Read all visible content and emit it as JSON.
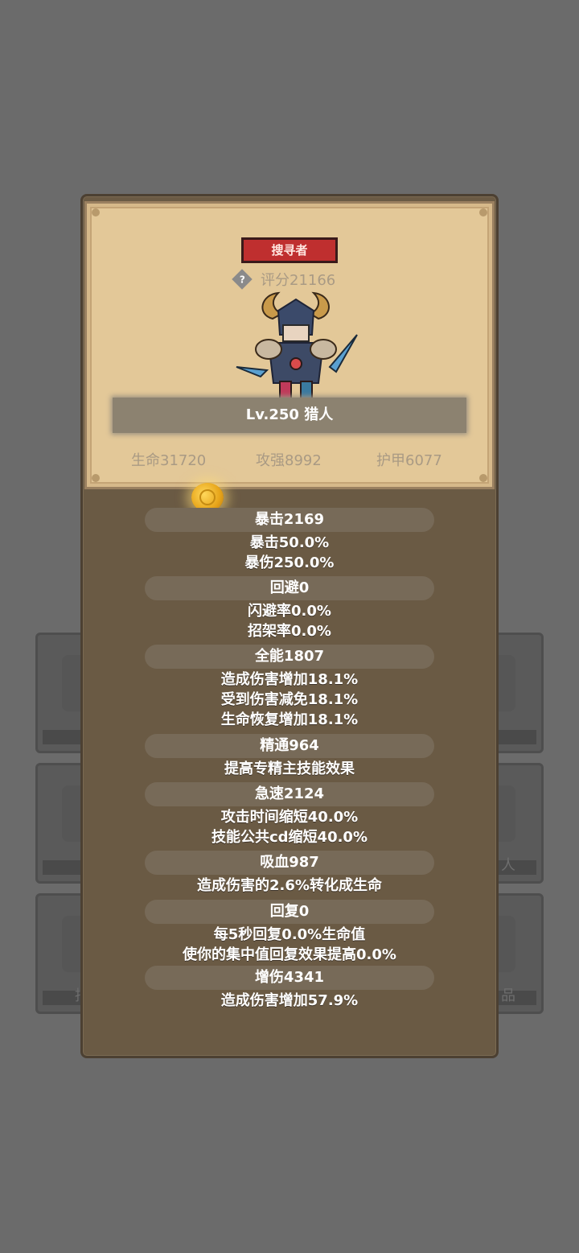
{
  "background_tiles": {
    "left_bottom_label": "抽",
    "right_middle_label": "人",
    "right_bottom_label": "品"
  },
  "card": {
    "class_badge": "搜寻者",
    "score": "评分21166",
    "help_icon": "question-diamond-icon",
    "hero_name": "Lv.250 猎人",
    "base_stats": {
      "hp": "生命31720",
      "attack": "攻强8992",
      "armor": "护甲6077"
    }
  },
  "stats": {
    "crit": {
      "header": "暴击2169",
      "lines": [
        "暴击50.0%",
        "暴伤250.0%"
      ]
    },
    "dodge": {
      "header": "回避0",
      "lines": [
        "闪避率0.0%",
        "招架率0.0%"
      ]
    },
    "versatility": {
      "header": "全能1807",
      "lines": [
        "造成伤害增加18.1%",
        "受到伤害减免18.1%",
        "生命恢复增加18.1%"
      ]
    },
    "mastery": {
      "header": "精通964",
      "lines": [
        "提高专精主技能效果"
      ]
    },
    "haste": {
      "header": "急速2124",
      "lines": [
        "攻击时间缩短40.0%",
        "技能公共cd缩短40.0%"
      ]
    },
    "leech": {
      "header": "吸血987",
      "lines": [
        "造成伤害的2.6%转化成生命"
      ]
    },
    "regen": {
      "header": "回复0",
      "lines": [
        "每5秒回复0.0%生命值",
        "使你的集中值回复效果提高0.0%"
      ]
    },
    "damage_bonus": {
      "header": "增伤4341",
      "lines": [
        "造成伤害增加57.9%"
      ]
    }
  },
  "colors": {
    "badge_red": "#bf2f2f",
    "card_parchment": "#e3c898",
    "panel_brown": "#6a5a44"
  }
}
